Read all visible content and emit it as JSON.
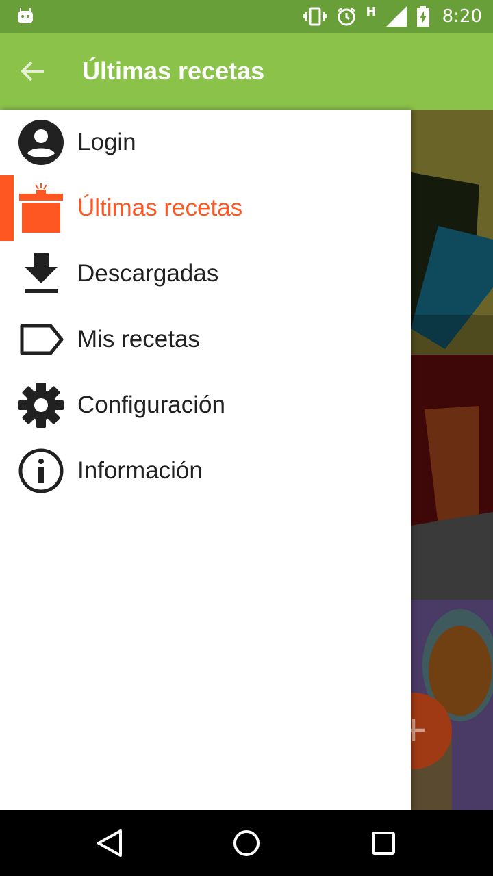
{
  "status_bar": {
    "time": "8:20",
    "network": "H",
    "icons": [
      "android-icon",
      "vibrate-icon",
      "alarm-icon",
      "signal-icon",
      "battery-charging-icon"
    ]
  },
  "app_bar": {
    "title": "Últimas recetas",
    "back_icon": "arrow-back-icon"
  },
  "drawer": {
    "items": [
      {
        "label": "Login",
        "icon": "account-circle-icon",
        "active": false
      },
      {
        "label": "Últimas recetas",
        "icon": "gift-box-icon",
        "active": true
      },
      {
        "label": "Descargadas",
        "icon": "download-icon",
        "active": false
      },
      {
        "label": "Mis recetas",
        "icon": "label-tag-icon",
        "active": false
      },
      {
        "label": "Configuración",
        "icon": "gear-icon",
        "active": false
      },
      {
        "label": "Información",
        "icon": "info-icon",
        "active": false
      }
    ]
  },
  "fab": {
    "symbol": "+"
  },
  "colors": {
    "primary": "#8bc34a",
    "primary_dark": "#689f38",
    "accent": "#ff5722"
  },
  "nav_bar": {
    "buttons": [
      "back-triangle-icon",
      "home-circle-icon",
      "recents-square-icon"
    ]
  }
}
